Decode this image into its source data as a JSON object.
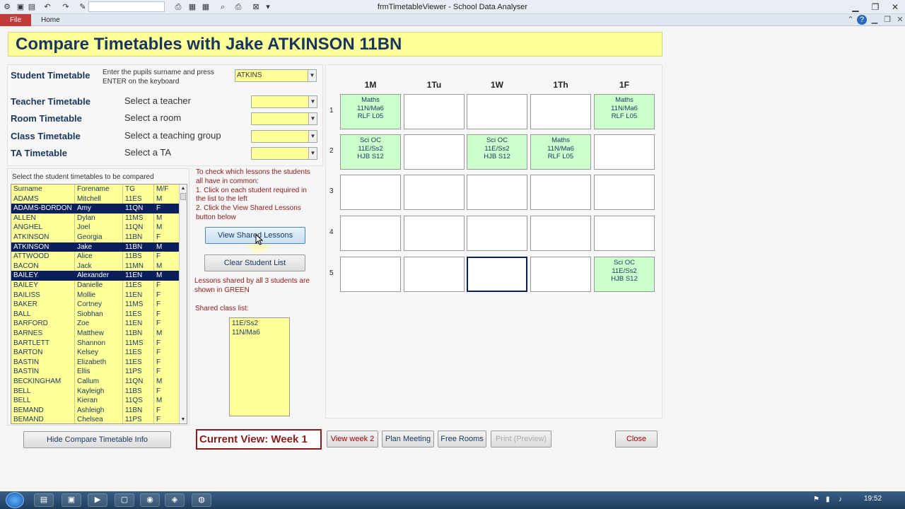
{
  "window": {
    "title": "frmTimetableViewer - School Data Analyser"
  },
  "ribbon": {
    "file": "File",
    "home": "Home"
  },
  "header": {
    "title": "Compare Timetables with Jake ATKINSON  11BN"
  },
  "filters": {
    "student": {
      "label": "Student Timetable",
      "hint1": "Enter the pupils surname and press",
      "hint2": "ENTER on the keyboard",
      "value": "ATKINS"
    },
    "teacher": {
      "label": "Teacher Timetable",
      "prompt": "Select a teacher",
      "value": ""
    },
    "room": {
      "label": "Room Timetable",
      "prompt": "Select a room",
      "value": ""
    },
    "class": {
      "label": "Class Timetable",
      "prompt": "Select a teaching group",
      "value": ""
    },
    "ta": {
      "label": "TA Timetable",
      "prompt": "Select a TA",
      "value": ""
    }
  },
  "student_list": {
    "caption": "Select the student timetables to be compared",
    "columns": [
      "Surname",
      "Forename",
      "TG",
      "M/F"
    ],
    "rows": [
      {
        "surname": "ADAMS",
        "forename": "Mitchell",
        "tg": "11ES",
        "mf": "M",
        "selected": false
      },
      {
        "surname": "ADAMS-BORDON",
        "forename": "Amy",
        "tg": "11QN",
        "mf": "F",
        "selected": true
      },
      {
        "surname": "ALLEN",
        "forename": "Dylan",
        "tg": "11MS",
        "mf": "M",
        "selected": false
      },
      {
        "surname": "ANGHEL",
        "forename": "Joel",
        "tg": "11QN",
        "mf": "M",
        "selected": false
      },
      {
        "surname": "ATKINSON",
        "forename": "Georgia",
        "tg": "11BN",
        "mf": "F",
        "selected": false
      },
      {
        "surname": "ATKINSON",
        "forename": "Jake",
        "tg": "11BN",
        "mf": "M",
        "selected": true
      },
      {
        "surname": "ATTWOOD",
        "forename": "Alice",
        "tg": "11BS",
        "mf": "F",
        "selected": false
      },
      {
        "surname": "BACON",
        "forename": "Jack",
        "tg": "11MN",
        "mf": "M",
        "selected": false
      },
      {
        "surname": "BAILEY",
        "forename": "Alexander",
        "tg": "11EN",
        "mf": "M",
        "selected": true
      },
      {
        "surname": "BAILEY",
        "forename": "Danielle",
        "tg": "11ES",
        "mf": "F",
        "selected": false
      },
      {
        "surname": "BAILISS",
        "forename": "Mollie",
        "tg": "11EN",
        "mf": "F",
        "selected": false
      },
      {
        "surname": "BAKER",
        "forename": "Cortney",
        "tg": "11MS",
        "mf": "F",
        "selected": false
      },
      {
        "surname": "BALL",
        "forename": "Siobhan",
        "tg": "11ES",
        "mf": "F",
        "selected": false
      },
      {
        "surname": "BARFORD",
        "forename": "Zoe",
        "tg": "11EN",
        "mf": "F",
        "selected": false
      },
      {
        "surname": "BARNES",
        "forename": "Matthew",
        "tg": "11BN",
        "mf": "M",
        "selected": false
      },
      {
        "surname": "BARTLETT",
        "forename": "Shannon",
        "tg": "11MS",
        "mf": "F",
        "selected": false
      },
      {
        "surname": "BARTON",
        "forename": "Kelsey",
        "tg": "11ES",
        "mf": "F",
        "selected": false
      },
      {
        "surname": "BASTIN",
        "forename": "Elizabeth",
        "tg": "11ES",
        "mf": "F",
        "selected": false
      },
      {
        "surname": "BASTIN",
        "forename": "Ellis",
        "tg": "11PS",
        "mf": "F",
        "selected": false
      },
      {
        "surname": "BECKINGHAM",
        "forename": "Callum",
        "tg": "11QN",
        "mf": "M",
        "selected": false
      },
      {
        "surname": "BELL",
        "forename": "Kayleigh",
        "tg": "11BS",
        "mf": "F",
        "selected": false
      },
      {
        "surname": "BELL",
        "forename": "Kieran",
        "tg": "11QS",
        "mf": "M",
        "selected": false
      },
      {
        "surname": "BEMAND",
        "forename": "Ashleigh",
        "tg": "11BN",
        "mf": "F",
        "selected": false
      },
      {
        "surname": "BEMAND",
        "forename": "Chelsea",
        "tg": "11PS",
        "mf": "F",
        "selected": false
      }
    ]
  },
  "instructions": {
    "lines": [
      "To check which lessons the students",
      "all have in common:",
      "1. Click on each student required in",
      "the list to the left",
      "2. Click the View Shared Lessons",
      "button below"
    ],
    "view_shared_btn": "View Shared Lessons",
    "clear_btn": "Clear Student List",
    "shared_note": [
      "Lessons shared by all 3 students are",
      "shown in GREEN"
    ],
    "shared_class_label": "Shared class list:",
    "shared_classes": [
      "11E/Ss2",
      "11N/Ma6"
    ]
  },
  "timetable": {
    "days": [
      "1M",
      "1Tu",
      "1W",
      "1Th",
      "1F"
    ],
    "periods": [
      "1",
      "2",
      "3",
      "4",
      "5"
    ],
    "cells": [
      [
        [
          "Maths",
          "11N/Ma6",
          "RLF   L05"
        ],
        [],
        [],
        [],
        [
          "Maths",
          "11N/Ma6",
          "RLF   L05"
        ]
      ],
      [
        [
          "Sci OC",
          "11E/Ss2",
          "HJB   S12"
        ],
        [],
        [
          "Sci OC",
          "11E/Ss2",
          "HJB   S12"
        ],
        [
          "Maths",
          "11N/Ma6",
          "RLF   L05"
        ],
        []
      ],
      [
        [],
        [],
        [],
        [],
        []
      ],
      [
        [],
        [],
        [],
        [],
        []
      ],
      [
        [],
        [],
        [],
        [],
        [
          "Sci OC",
          "11E/Ss2",
          "HJB   S12"
        ]
      ]
    ]
  },
  "bottom": {
    "hide_btn": "Hide Compare Timetable Info",
    "current_view": "Current View:  Week 1",
    "view_week2": "View week 2",
    "plan_meeting": "Plan Meeting",
    "free_rooms": "Free Rooms",
    "print_preview": "Print (Preview)",
    "close": "Close"
  },
  "taskbar": {
    "clock": "19:52"
  },
  "colors": {
    "accent_yellow": "#ffff99",
    "shared_green": "#ccffcc",
    "navy": "#17365d",
    "selection": "#0a1f5c",
    "maroon": "#8b1a1a"
  }
}
